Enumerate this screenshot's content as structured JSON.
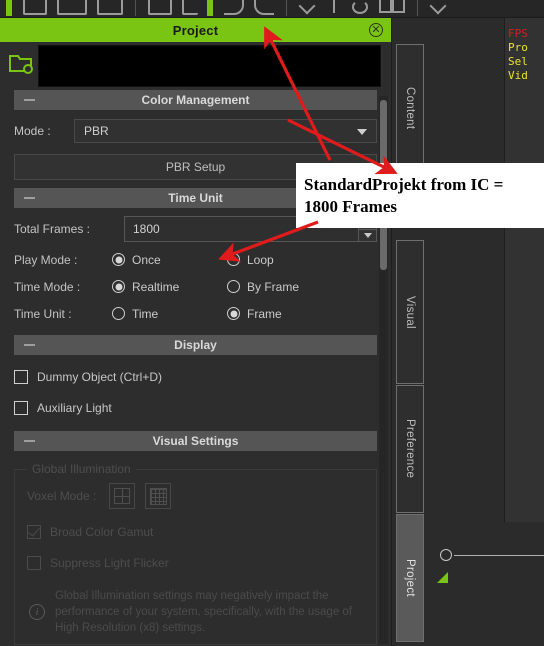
{
  "toolbar": {
    "name": "top-toolbar"
  },
  "panel": {
    "title": "Project",
    "close_label": "✕",
    "project_field_value": "",
    "sections": {
      "color_management": {
        "header": "Color Management",
        "mode_label": "Mode :",
        "mode_value": "PBR",
        "setup_button": "PBR Setup"
      },
      "time_unit": {
        "header": "Time Unit",
        "total_frames_label": "Total Frames :",
        "total_frames_value": "1800",
        "play_mode_label": "Play Mode :",
        "play_mode_options": [
          {
            "label": "Once",
            "selected": true
          },
          {
            "label": "Loop",
            "selected": false
          }
        ],
        "time_mode_label": "Time Mode :",
        "time_mode_options": [
          {
            "label": "Realtime",
            "selected": true
          },
          {
            "label": "By Frame",
            "selected": false
          }
        ],
        "time_unit_label": "Time Unit :",
        "time_unit_options": [
          {
            "label": "Time",
            "selected": false
          },
          {
            "label": "Frame",
            "selected": true
          }
        ]
      },
      "display": {
        "header": "Display",
        "checkboxes": [
          {
            "label": "Dummy Object (Ctrl+D)",
            "checked": false
          },
          {
            "label": "Auxiliary Light",
            "checked": false
          }
        ]
      },
      "visual_settings": {
        "header": "Visual Settings",
        "group_title": "Global Illumination",
        "voxel_label": "Voxel Mode :",
        "broad_color_gamut": {
          "label": "Broad Color Gamut",
          "checked": true
        },
        "suppress_light_flicker": {
          "label": "Suppress Light Flicker",
          "checked": false
        },
        "info_text": "Global Illumination settings may negatively impact the performance of your system, specifically, with the usage of High Resolution (x8) settings."
      }
    }
  },
  "tabs": [
    {
      "label": "Content",
      "active": false
    },
    {
      "label": "Visual",
      "active": false
    },
    {
      "label": "Preference",
      "active": false
    },
    {
      "label": "Project",
      "active": true
    }
  ],
  "viewport": {
    "hud": [
      "FPS",
      "Pro",
      "Sel",
      "Vid"
    ]
  },
  "annotation": {
    "callout_line1": "StandardProjekt from IC =",
    "callout_line2": "1800 Frames",
    "arrow_color": "#e01b1b"
  },
  "colors": {
    "accent_green": "#7ac414",
    "panel_bg": "#2d2d2d",
    "section_header": "#555555"
  }
}
